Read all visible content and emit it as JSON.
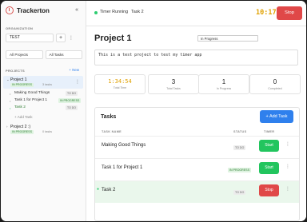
{
  "app": {
    "name": "Trackerton"
  },
  "sidebar": {
    "org_label": "ORGANIZATION",
    "org_value": "TEST",
    "org_add": "+",
    "filters": [
      "All Projects",
      "All Tasks"
    ],
    "projects_label": "PROJECTS",
    "new_label": "+ New",
    "projects": [
      {
        "name": "Project 1",
        "status": "IN PROGRESS",
        "count": "3 tasks",
        "tasks": [
          {
            "name": "Making Good Things",
            "tag": "TO DO"
          },
          {
            "name": "Task 1 for Project 1",
            "tag": "IN PROGRESS"
          },
          {
            "name": "Task 2",
            "tag": "TO DO"
          }
        ],
        "add_task": "+ Add Task"
      },
      {
        "name": "Project 2 :)",
        "status": "IN PROGRESS",
        "count": "0 tasks"
      }
    ]
  },
  "topbar": {
    "running_label": "Timer Running",
    "running_task": "Task 2",
    "timer": "10:17",
    "stop_label": "Stop"
  },
  "main": {
    "project_title": "Project 1",
    "status_select": "In Progress",
    "description": "This is a test project to test my timer app",
    "stats": [
      {
        "value": "1:34:54",
        "label": "Total Time"
      },
      {
        "value": "3",
        "label": "Total Tasks"
      },
      {
        "value": "1",
        "label": "In Progress"
      },
      {
        "value": "0",
        "label": "Completed"
      }
    ],
    "tasks_title": "Tasks",
    "add_task_label": "+ Add Task",
    "columns": [
      "TASK NAME",
      "STATUS",
      "TIMER"
    ],
    "rows": [
      {
        "name": "Making Good Things",
        "status": "TO DO",
        "action": "Start"
      },
      {
        "name": "Task 1 for Project 1",
        "status": "IN PROGRESS",
        "action": "Start"
      },
      {
        "name": "Task 2",
        "status": "TO DO",
        "action": "Stop"
      }
    ]
  },
  "colors": {
    "accent": "#2f80ed",
    "start": "#22c55e",
    "stop": "#e04848",
    "timer": "#e0a100",
    "active_row": "#eaf7ec"
  }
}
